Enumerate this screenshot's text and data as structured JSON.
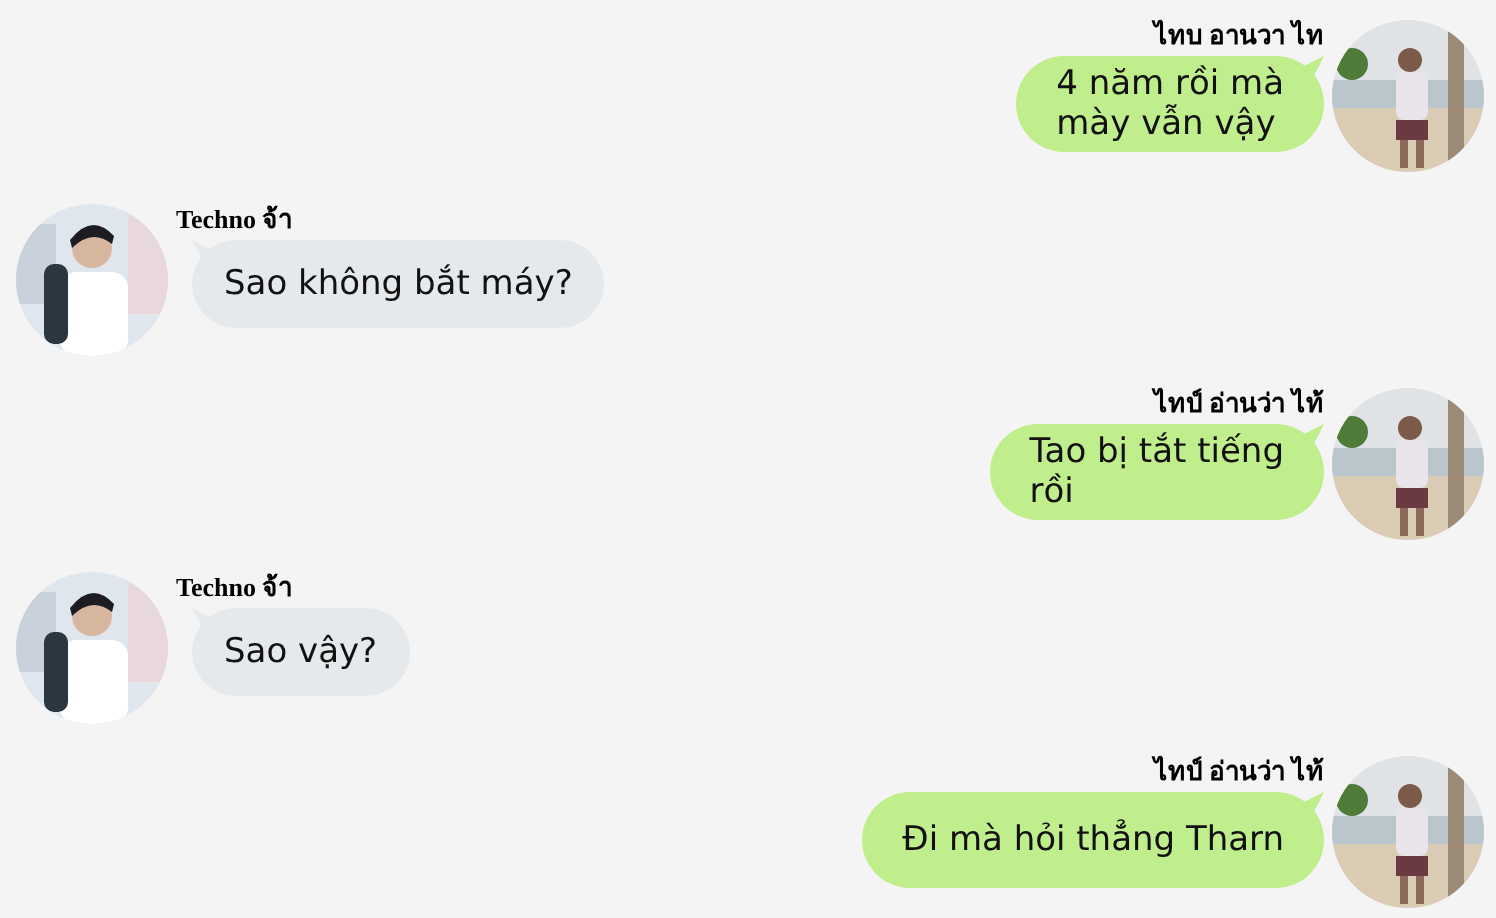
{
  "messages": [
    {
      "kind": "sent",
      "sender": "ไทบ อานวา ไท",
      "lines": [
        "4 năm rồi mà",
        "mày vẫn vậy"
      ]
    },
    {
      "kind": "received",
      "sender": "Techno จ้า",
      "lines": [
        "Sao không bắt máy?"
      ]
    },
    {
      "kind": "sent",
      "sender": "ไทป์ อ่านว่า ไท้",
      "lines": [
        "Tao bị tắt tiếng",
        "rồi"
      ]
    },
    {
      "kind": "received",
      "sender": "Techno จ้า",
      "lines": [
        "Sao vậy?"
      ]
    },
    {
      "kind": "sent",
      "sender": "ไทป์ อ่านว่า ไท้",
      "lines": [
        "Đi mà hỏi thẳng Tharn"
      ]
    }
  ]
}
